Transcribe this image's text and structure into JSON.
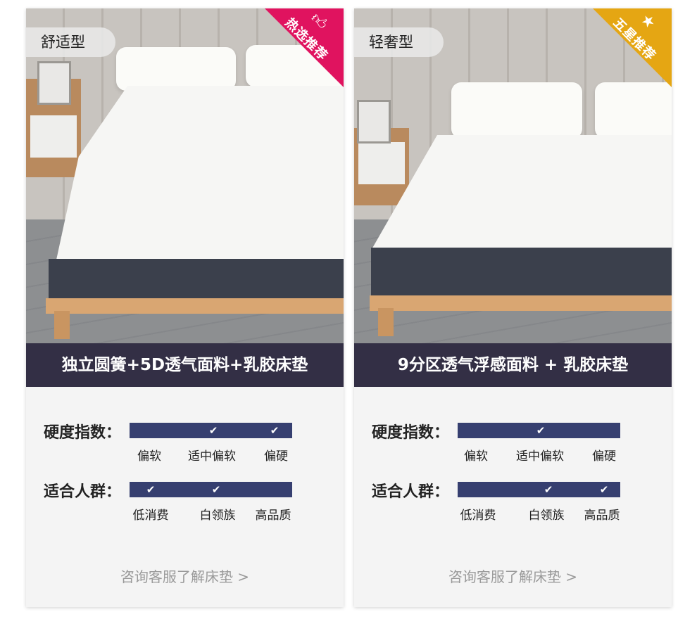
{
  "cards": [
    {
      "type_tag": "舒适型",
      "ribbon": {
        "text": "热选推荐",
        "icon": "thumbs-up-icon",
        "color": "#e0135f"
      },
      "feature": "独立圆簧+5D透气面料+乳胶床垫",
      "hardness_label": "硬度指数：",
      "hardness_options": [
        "偏软",
        "适中偏软",
        "偏硬"
      ],
      "hardness_checked": [
        false,
        true,
        true
      ],
      "crowd_label": "适合人群：",
      "crowd_options": [
        "低消费",
        "白领族",
        "高品质"
      ],
      "crowd_checked": [
        true,
        true,
        false
      ],
      "consult": "咨询客服了解床垫 >"
    },
    {
      "type_tag": "轻奢型",
      "ribbon": {
        "text": "五星推荐",
        "icon": "star-icon",
        "color": "#e5a613"
      },
      "feature": "9分区透气浮感面料 + 乳胶床垫",
      "hardness_label": "硬度指数：",
      "hardness_options": [
        "偏软",
        "适中偏软",
        "偏硬"
      ],
      "hardness_checked": [
        false,
        true,
        false
      ],
      "crowd_label": "适合人群：",
      "crowd_options": [
        "低消费",
        "白领族",
        "高品质"
      ],
      "crowd_checked": [
        false,
        true,
        true
      ],
      "consult": "咨询客服了解床垫 >"
    }
  ],
  "colors": {
    "banner": "#332f45",
    "bar": "#363f70",
    "consult_text": "#9a9a9a"
  }
}
